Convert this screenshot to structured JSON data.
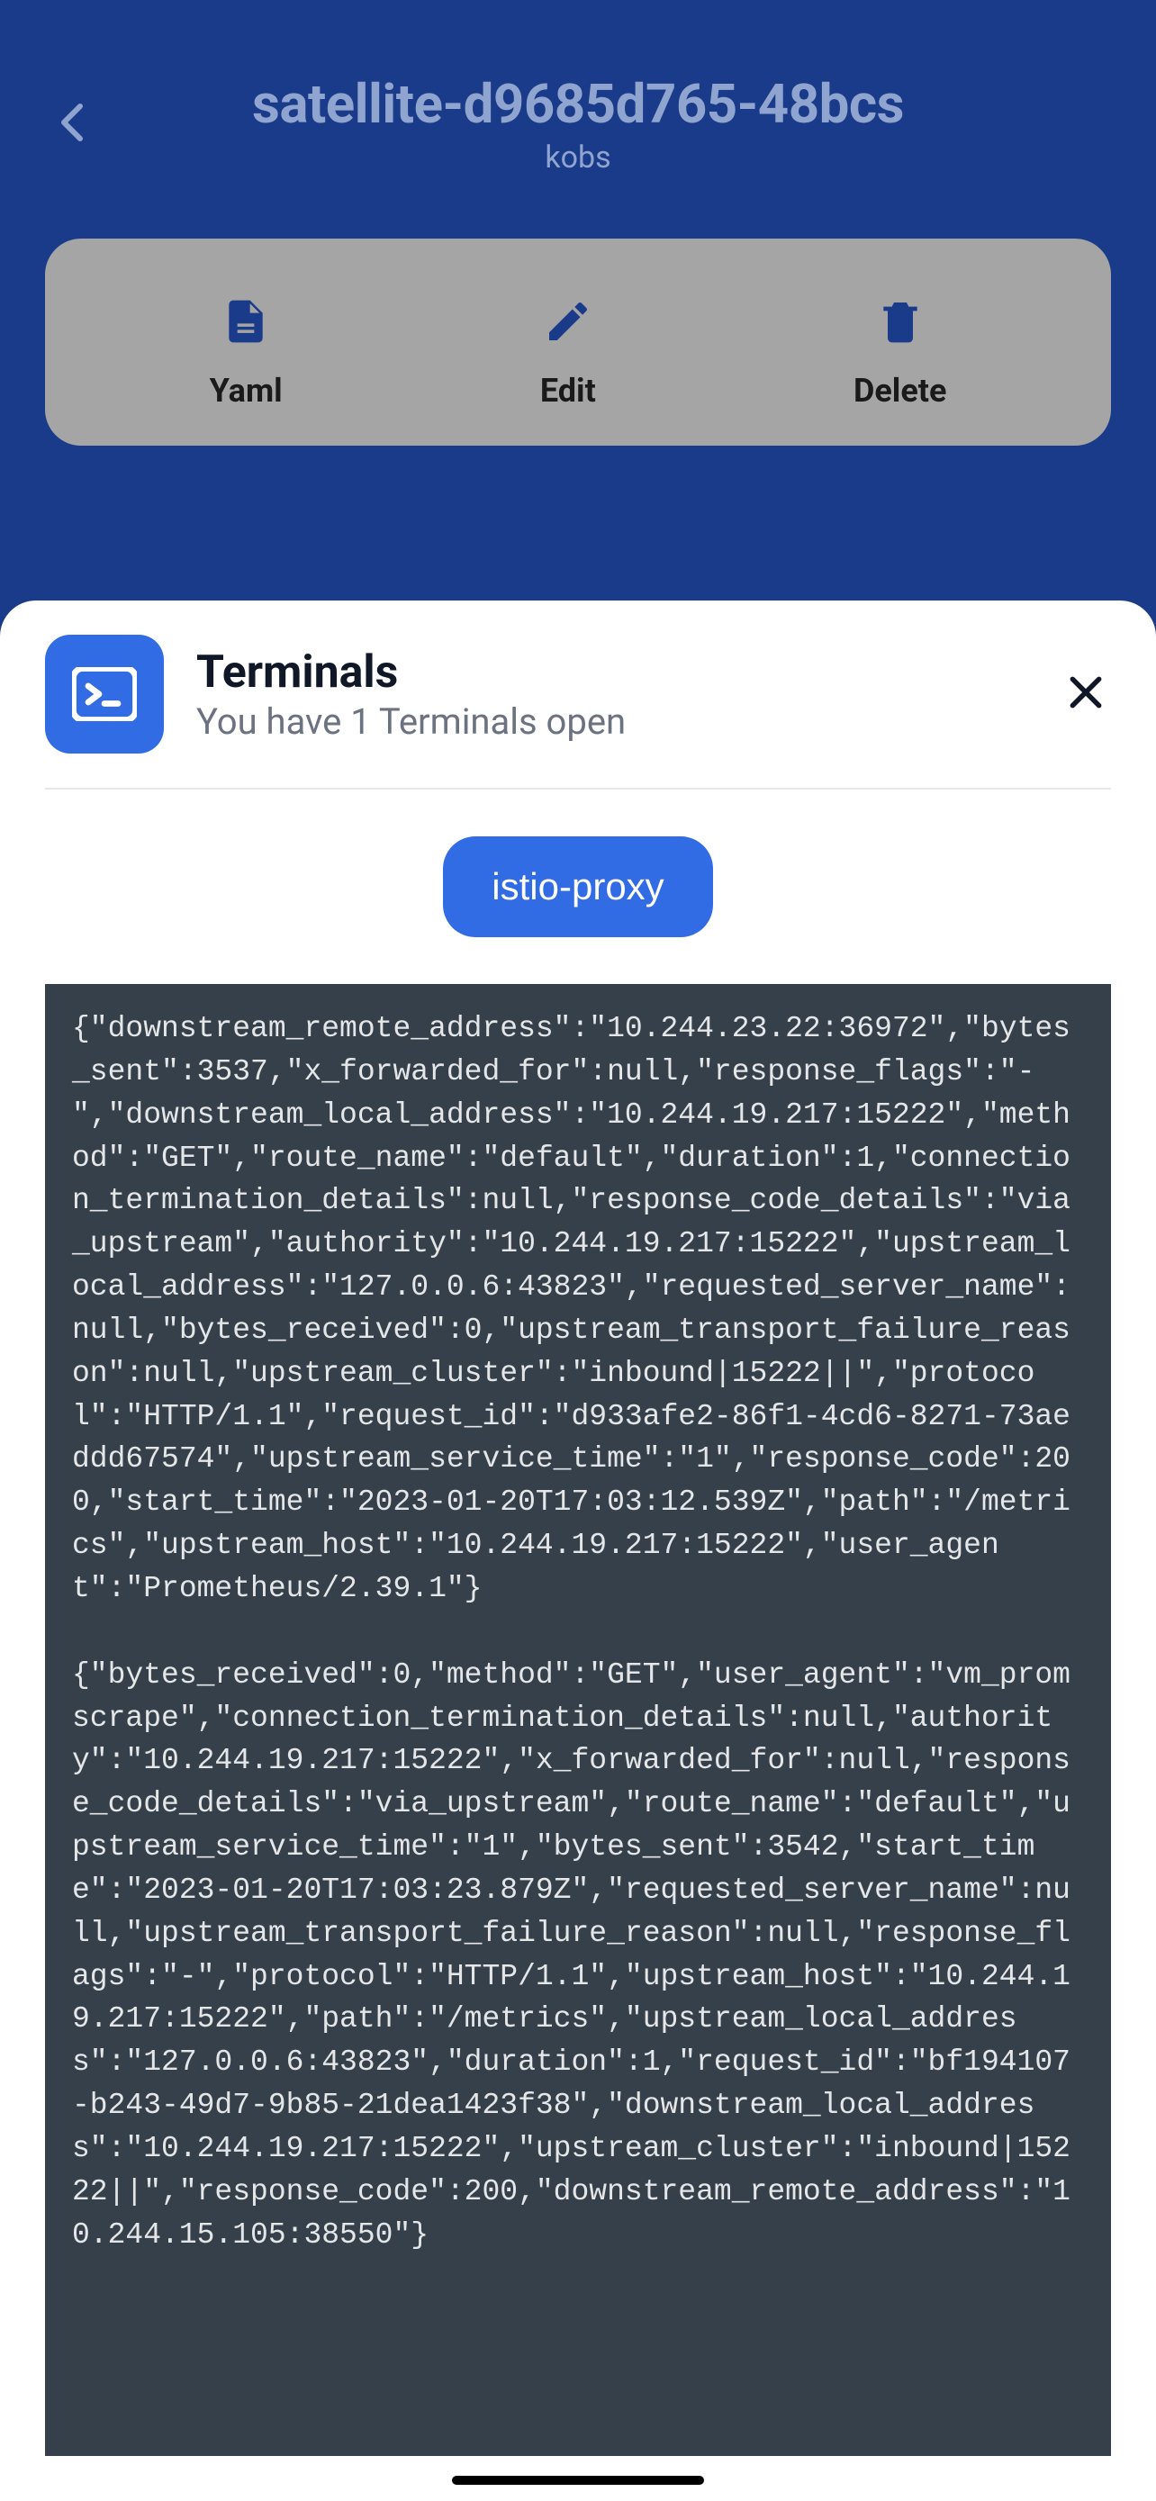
{
  "header": {
    "title": "satellite-d9685d765-48bcs",
    "subtitle": "kobs"
  },
  "actions": {
    "yaml": {
      "label": "Yaml"
    },
    "edit": {
      "label": "Edit"
    },
    "delete": {
      "label": "Delete"
    }
  },
  "modal": {
    "title": "Terminals",
    "subtitle": "You have 1 Terminals open",
    "tab_label": "istio-proxy",
    "terminal_output": "{\"downstream_remote_address\":\"10.244.23.22:36972\",\"bytes_sent\":3537,\"x_forwarded_for\":null,\"response_flags\":\"-\",\"downstream_local_address\":\"10.244.19.217:15222\",\"method\":\"GET\",\"route_name\":\"default\",\"duration\":1,\"connection_termination_details\":null,\"response_code_details\":\"via_upstream\",\"authority\":\"10.244.19.217:15222\",\"upstream_local_address\":\"127.0.0.6:43823\",\"requested_server_name\":null,\"bytes_received\":0,\"upstream_transport_failure_reason\":null,\"upstream_cluster\":\"inbound|15222||\",\"protocol\":\"HTTP/1.1\",\"request_id\":\"d933afe2-86f1-4cd6-8271-73aeddd67574\",\"upstream_service_time\":\"1\",\"response_code\":200,\"start_time\":\"2023-01-20T17:03:12.539Z\",\"path\":\"/metrics\",\"upstream_host\":\"10.244.19.217:15222\",\"user_agent\":\"Prometheus/2.39.1\"}\n\n{\"bytes_received\":0,\"method\":\"GET\",\"user_agent\":\"vm_promscrape\",\"connection_termination_details\":null,\"authority\":\"10.244.19.217:15222\",\"x_forwarded_for\":null,\"response_code_details\":\"via_upstream\",\"route_name\":\"default\",\"upstream_service_time\":\"1\",\"bytes_sent\":3542,\"start_time\":\"2023-01-20T17:03:23.879Z\",\"requested_server_name\":null,\"upstream_transport_failure_reason\":null,\"response_flags\":\"-\",\"protocol\":\"HTTP/1.1\",\"upstream_host\":\"10.244.19.217:15222\",\"path\":\"/metrics\",\"upstream_local_address\":\"127.0.0.6:43823\",\"duration\":1,\"request_id\":\"bf194107-b243-49d7-9b85-21dea1423f38\",\"downstream_local_address\":\"10.244.19.217:15222\",\"upstream_cluster\":\"inbound|15222||\",\"response_code\":200,\"downstream_remote_address\":\"10.244.15.105:38550\"}"
  }
}
